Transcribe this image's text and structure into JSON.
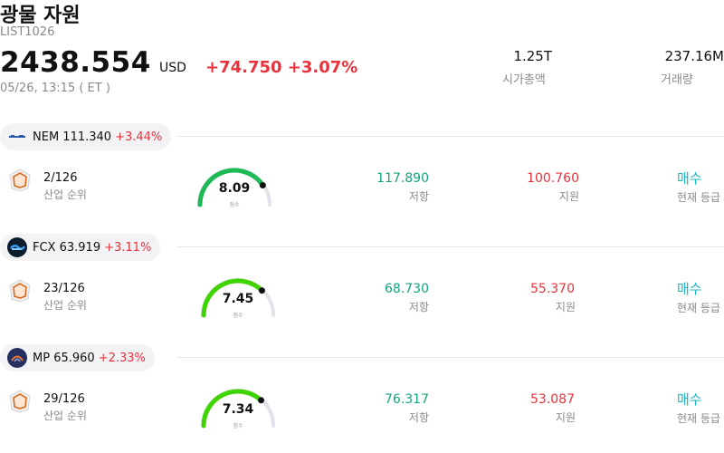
{
  "header": {
    "title": "광물 자원",
    "code": "LIST1026",
    "price": "2438.554",
    "currency": "USD",
    "change": "+74.750 +3.07%",
    "timestamp": "05/26, 13:15 ( ET )",
    "market_cap_value": "1.25T",
    "market_cap_label": "시가총액",
    "volume_value": "237.16M",
    "volume_label": "거래량"
  },
  "colors": {
    "up": "#e8323c",
    "resistance": "#11a37f",
    "rating": "#18b5c5",
    "gauge_dark": "#1db954",
    "gauge_bright": "#3fd400"
  },
  "items": [
    {
      "ticker": "NEM",
      "price": "111.340",
      "change_pct": "+3.44%",
      "rank": "2/126",
      "rank_label": "산업 순위",
      "score": "8.09",
      "score_label": "점수",
      "score_value": 8.09,
      "resistance": "117.890",
      "resistance_label": "저항",
      "support": "100.760",
      "support_label": "지원",
      "rating": "매수",
      "rating_label": "현재 등급",
      "logo_icon": "newmont-logo-icon"
    },
    {
      "ticker": "FCX",
      "price": "63.919",
      "change_pct": "+3.11%",
      "rank": "23/126",
      "rank_label": "산업 순위",
      "score": "7.45",
      "score_label": "점수",
      "score_value": 7.45,
      "resistance": "68.730",
      "resistance_label": "저항",
      "support": "55.370",
      "support_label": "지원",
      "rating": "매수",
      "rating_label": "현재 등급",
      "logo_icon": "freeport-logo-icon"
    },
    {
      "ticker": "MP",
      "price": "65.960",
      "change_pct": "+2.33%",
      "rank": "29/126",
      "rank_label": "산업 순위",
      "score": "7.34",
      "score_label": "점수",
      "score_value": 7.34,
      "resistance": "76.317",
      "resistance_label": "저항",
      "support": "53.087",
      "support_label": "지원",
      "rating": "매수",
      "rating_label": "현재 등급",
      "logo_icon": "mp-materials-logo-icon"
    }
  ]
}
